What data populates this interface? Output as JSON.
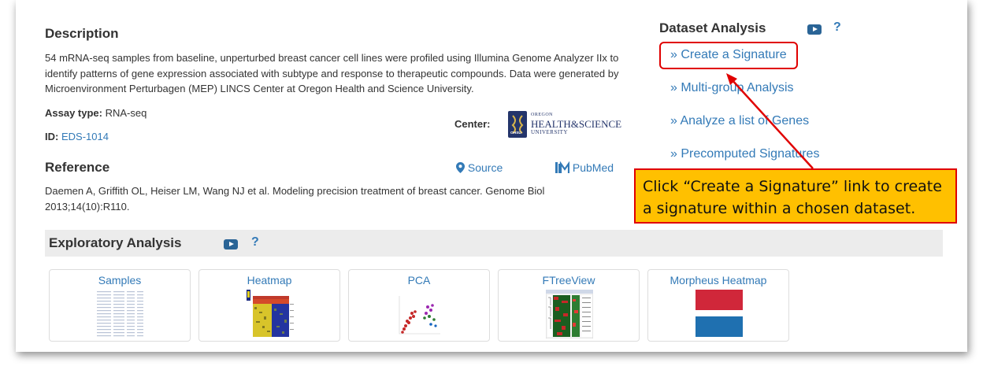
{
  "description": {
    "heading": "Description",
    "text": "54 mRNA-seq samples from baseline, unperturbed breast cancer cell lines were profiled using Illumina Genome Analyzer IIx to identify patterns of gene expression associated with subtype and response to therapeutic compounds. Data were generated by Microenvironment Perturbagen (MEP) LINCS Center at Oregon Health and Science University.",
    "assay_label": "Assay type:",
    "assay_value": "RNA-seq",
    "id_label": "ID:",
    "id_value": "EDS-1014",
    "center_label": "Center:",
    "center_logo_small": "OREGON",
    "center_logo_big": "HEALTH&SCIENCE",
    "center_logo_sub": "UNIVERSITY",
    "center_seal_text": "OHSU"
  },
  "reference": {
    "heading": "Reference",
    "source_label": "Source",
    "pubmed_label": "PubMed",
    "text": "Daemen A, Griffith OL, Heiser LM, Wang NJ et al. Modeling precision treatment of breast cancer. Genome Biol 2013;14(10):R110."
  },
  "dataset_analysis": {
    "heading": "Dataset Analysis",
    "help": "?",
    "links": [
      "» Create a Signature",
      "» Multi-group Analysis",
      "» Analyze a list of Genes",
      "» Precomputed Signatures"
    ]
  },
  "callout": {
    "line1": "Click “Create a Signature” link to create",
    "line2": "a signature within a chosen dataset."
  },
  "exploratory": {
    "heading": "Exploratory Analysis",
    "help": "?",
    "cards": [
      "Samples",
      "Heatmap",
      "PCA",
      "FTreeView",
      "Morpheus Heatmap"
    ]
  },
  "colors": {
    "link": "#337ab7",
    "callout_bg": "#ffc000",
    "callout_border": "#e00000",
    "morpheus_red": "#d0273a",
    "morpheus_blue": "#1f70b0"
  }
}
